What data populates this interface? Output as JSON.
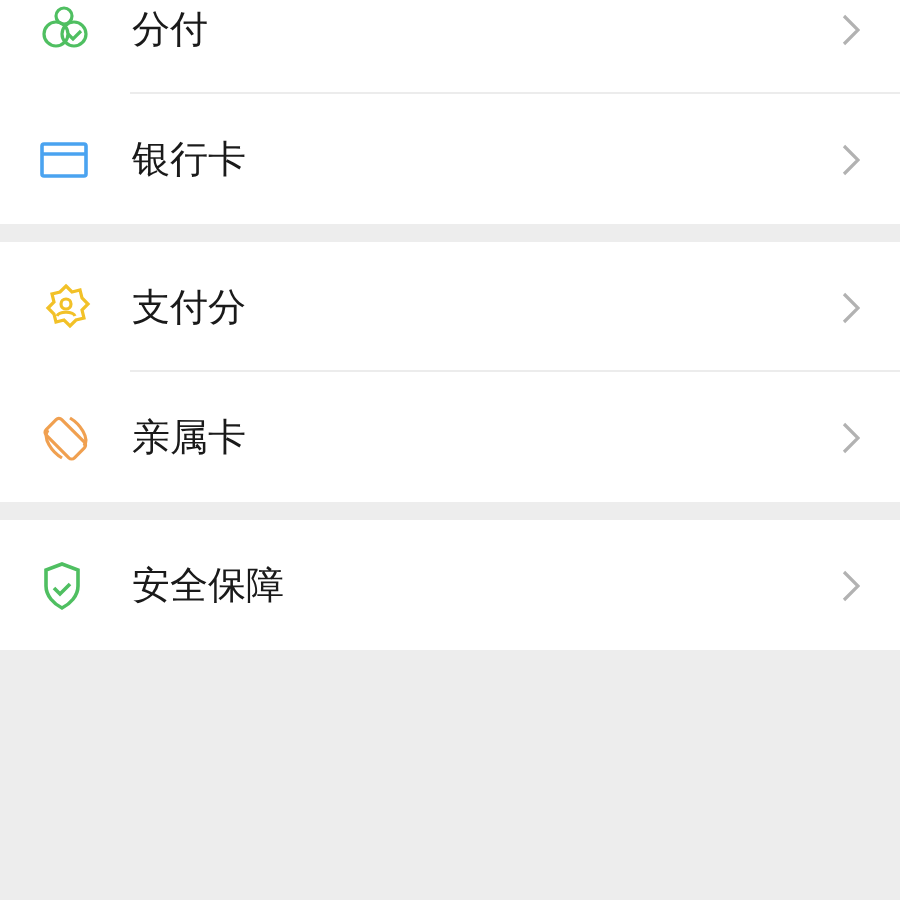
{
  "groups": [
    {
      "items": [
        {
          "label": "分付"
        },
        {
          "label": "银行卡"
        }
      ]
    },
    {
      "items": [
        {
          "label": "支付分"
        },
        {
          "label": "亲属卡"
        }
      ]
    },
    {
      "items": [
        {
          "label": "安全保障"
        }
      ]
    }
  ]
}
